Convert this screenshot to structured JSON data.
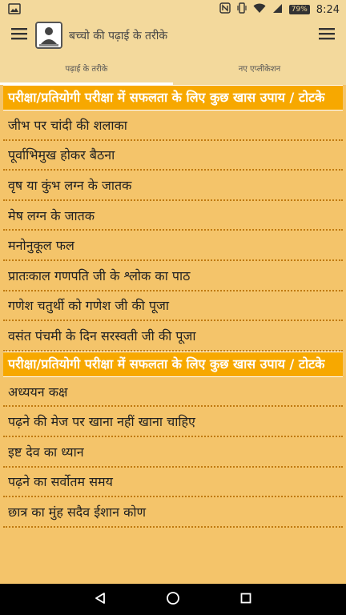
{
  "status": {
    "time": "8:24",
    "battery": "79%",
    "icons": [
      "image-icon",
      "nfc-icon",
      "vibrate-icon",
      "wifi-icon",
      "signal-icon",
      "battery-icon"
    ]
  },
  "app": {
    "title": "बच्चो की पढ़ाई के तरीके",
    "menu_icon": "hamburger-icon",
    "overflow_icon": "hamburger-icon"
  },
  "tabs": [
    {
      "label": "पढ़ाई के तरीके",
      "active": true
    },
    {
      "label": "नए एप्लीकेशन",
      "active": false
    }
  ],
  "sections": [
    {
      "header": "परीक्षा/प्रतियोगी परीक्षा में सफलता के लिए कुछ खास उपाय / टोटके",
      "items": [
        "जीभ पर चांदी की शलाका",
        "पूर्वाभिमुख होकर बैठना",
        "वृष या कुंभ लग्न के जातक",
        "मेष लग्न के जातक",
        "मनोनुकूल फल",
        "प्रातःकाल गणपति जी के श्लोक का पाठ",
        "गणेश चतुर्थी को गणेश जी की पूजा",
        "वसंत पंचमी के दिन सरस्वती जी की पूजा"
      ]
    },
    {
      "header": "परीक्षा/प्रतियोगी परीक्षा में सफलता के लिए कुछ खास उपाय / टोटके",
      "items": [
        "अध्ययन कक्ष",
        "पढ़ने की मेज पर खाना नहीं खाना चाहिए",
        "इष्ट देव का ध्यान",
        "पढ़ने का सर्वोतम समय",
        "छात्र का मुंह सदैव ईशान कोण"
      ]
    }
  ],
  "nav": {
    "icons": [
      "back-icon",
      "home-icon",
      "recents-icon"
    ]
  }
}
